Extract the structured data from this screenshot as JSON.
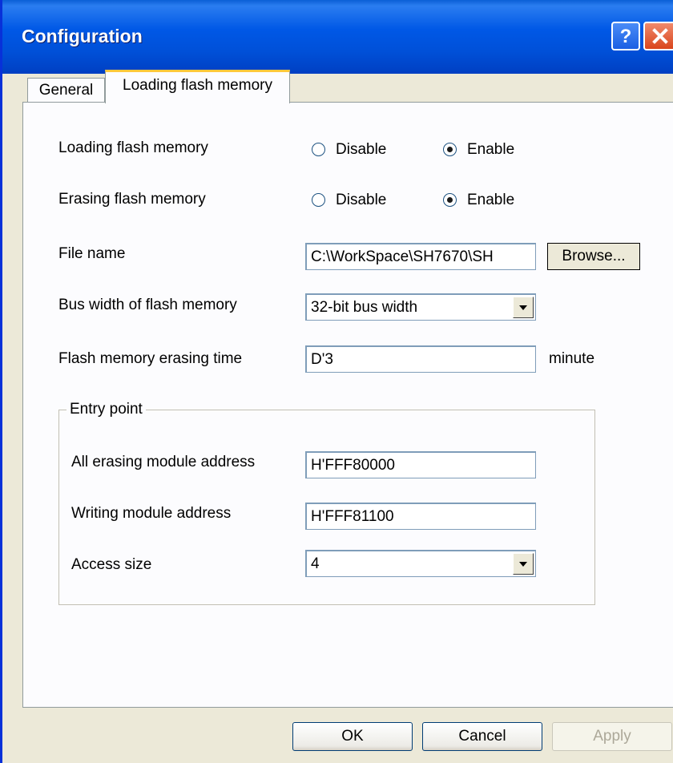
{
  "window": {
    "title": "Configuration"
  },
  "tabs": [
    {
      "label": "General",
      "active": false
    },
    {
      "label": "Loading flash memory",
      "active": true
    }
  ],
  "loading_flash": {
    "label": "Loading flash memory",
    "options": [
      "Disable",
      "Enable"
    ],
    "selected": "Enable"
  },
  "erasing_flash": {
    "label": "Erasing flash memory",
    "options": [
      "Disable",
      "Enable"
    ],
    "selected": "Enable"
  },
  "file_name": {
    "label": "File name",
    "value": "C:\\WorkSpace\\SH7670\\SH",
    "browse_label": "Browse..."
  },
  "bus_width": {
    "label": "Bus width of flash memory",
    "value": "32-bit bus width"
  },
  "erasing_time": {
    "label": "Flash memory erasing time",
    "value": "D'3",
    "unit": "minute"
  },
  "entry_point": {
    "legend": "Entry point",
    "all_erasing": {
      "label": "All erasing module address",
      "value": "H'FFF80000"
    },
    "writing": {
      "label": "Writing module address",
      "value": "H'FFF81100"
    },
    "access_size": {
      "label": "Access size",
      "value": "4"
    }
  },
  "buttons": {
    "ok": "OK",
    "cancel": "Cancel",
    "apply": "Apply"
  },
  "colors": {
    "titlebar": "#0058e6",
    "window_bg": "#ece9d8",
    "tab_highlight": "#ffc83c"
  }
}
